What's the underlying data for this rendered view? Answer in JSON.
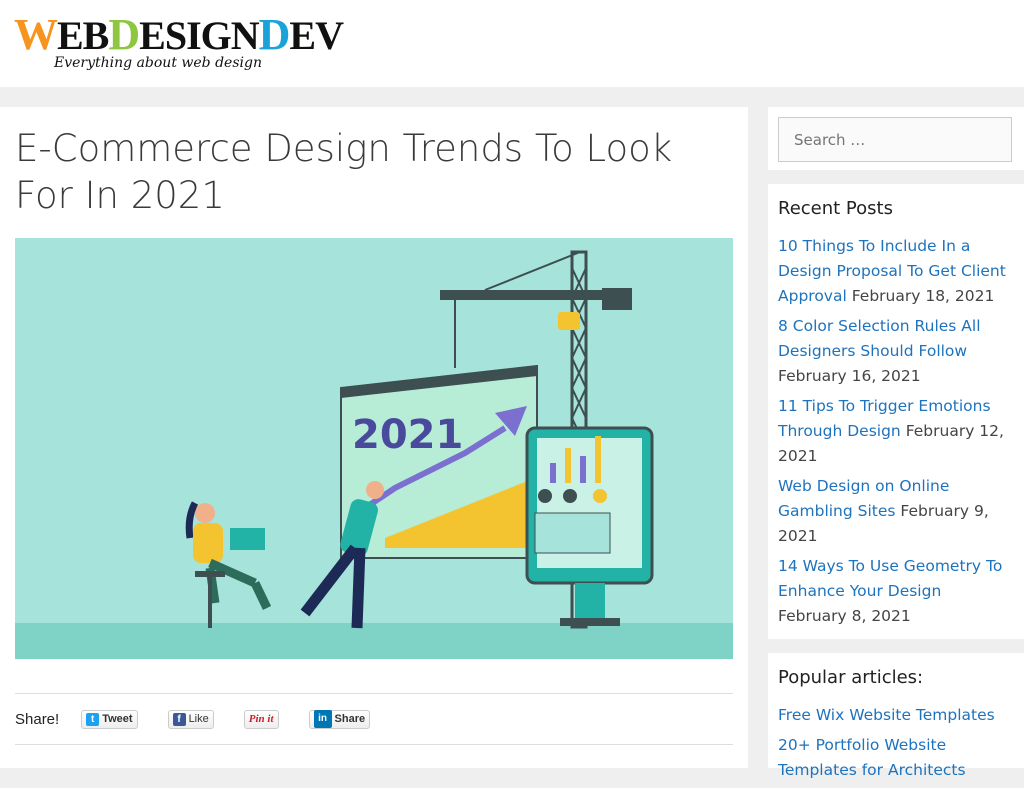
{
  "site": {
    "logo_parts": [
      "W",
      "EB",
      "D",
      "ESIGN",
      "D",
      "EV"
    ],
    "tagline": "Everything about web design"
  },
  "article": {
    "title": "E-Commerce Design Trends To Look For In 2021",
    "hero_year": "2021"
  },
  "share": {
    "label": "Share!",
    "tweet": "Tweet",
    "like": "Like",
    "pin": "Pin it",
    "linkedin": "Share"
  },
  "search": {
    "placeholder": "Search …"
  },
  "recent_posts": {
    "title": "Recent Posts",
    "items": [
      {
        "title": "10 Things To Include In a Design Proposal To Get Client Approval",
        "date": "February 18, 2021"
      },
      {
        "title": "8 Color Selection Rules All Designers Should Follow",
        "date": "February 16, 2021"
      },
      {
        "title": "11 Tips To Trigger Emotions Through Design",
        "date": "February 12, 2021"
      },
      {
        "title": "Web Design on Online Gambling Sites",
        "date": "February 9, 2021"
      },
      {
        "title": "14 Ways To Use Geometry To Enhance Your Design",
        "date": "February 8, 2021"
      }
    ]
  },
  "popular": {
    "title": "Popular articles:",
    "items": [
      "Free Wix Website Templates",
      "20+ Portfolio Website Templates for Architects"
    ]
  },
  "colors": {
    "link": "#1e73be",
    "hero_bg": "#a6e3da",
    "logo_orange": "#f7941d",
    "logo_blue": "#1aa3d9"
  }
}
